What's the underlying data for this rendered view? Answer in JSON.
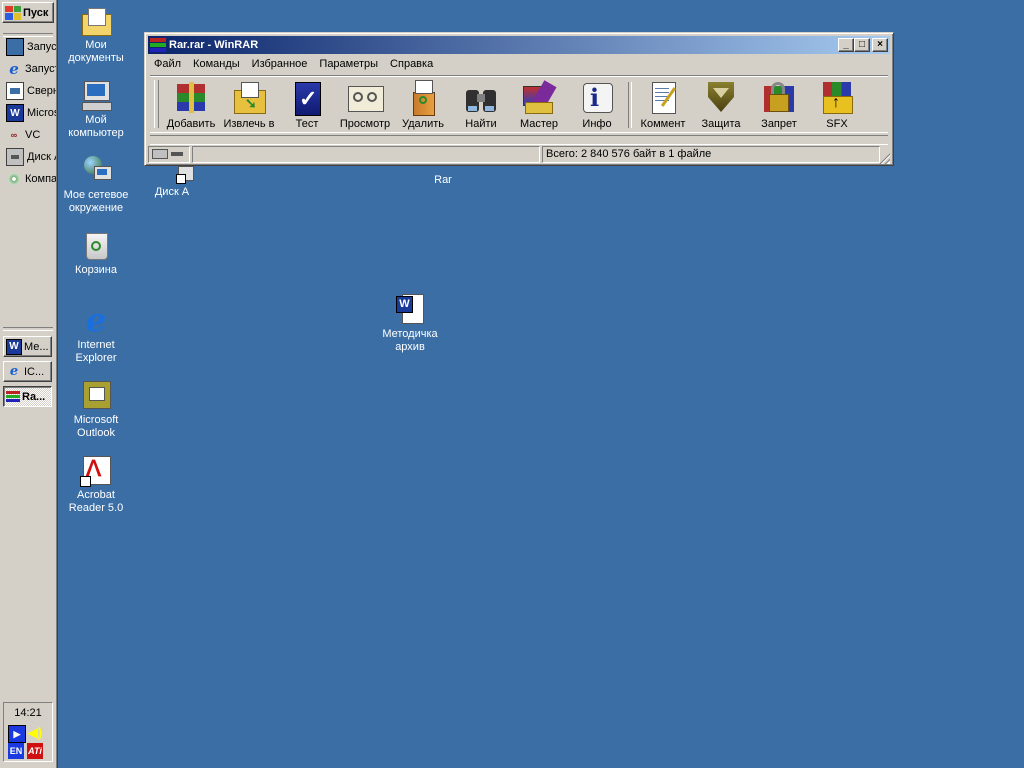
{
  "taskbar": {
    "start_label": "Пуск",
    "quick_launch": [
      {
        "label": "Запустить",
        "icon": "explorer-icon",
        "color": "#3a6ea5"
      },
      {
        "label": "Запустить Internet Explorer",
        "icon": "ie-icon",
        "color": "#1a5fd0"
      },
      {
        "label": "Свернуть все окна",
        "icon": "desktop-icon",
        "color": "#3a6ea5"
      },
      {
        "label": "Microsoft Word",
        "icon": "word-icon",
        "color": "#1a3a9a"
      },
      {
        "label": "VC",
        "icon": "vc-icon",
        "color": "#8a1a1a"
      },
      {
        "label": "Диск A",
        "icon": "floppy-icon",
        "color": "#555555"
      },
      {
        "label": "Компакт-диск",
        "icon": "cd-icon",
        "color": "#2a7a2a"
      }
    ],
    "tasks": [
      {
        "label": "Ме...",
        "icon": "word-icon"
      },
      {
        "label": "IC...",
        "icon": "ie-icon"
      },
      {
        "label": "Ra...",
        "icon": "winrar-icon"
      }
    ],
    "clock": "14:21",
    "tray": {
      "lang": "EN"
    }
  },
  "desktop": {
    "icons": [
      {
        "label": "Мои документы",
        "icon": "my-documents-icon"
      },
      {
        "label": "Мой компьютер",
        "icon": "my-computer-icon"
      },
      {
        "label": "Мое сетевое окружение",
        "icon": "network-icon"
      },
      {
        "label": "Корзина",
        "icon": "recycle-bin-icon"
      },
      {
        "label": "Internet Explorer",
        "icon": "internet-explorer-icon"
      },
      {
        "label": "Microsoft Outlook",
        "icon": "outlook-icon"
      },
      {
        "label": "Acrobat Reader 5.0",
        "icon": "acrobat-icon"
      },
      {
        "label": "Диск A",
        "icon": "floppy-shortcut-icon"
      },
      {
        "label": "Rar",
        "icon": "rar-folder-icon"
      },
      {
        "label": "Методичка архив",
        "icon": "word-document-icon"
      }
    ]
  },
  "window": {
    "title": "Rar.rar - WinRAR",
    "menu": [
      "Файл",
      "Команды",
      "Избранное",
      "Параметры",
      "Справка"
    ],
    "toolbar": [
      {
        "label": "Добавить",
        "icon": "add-icon"
      },
      {
        "label": "Извлечь в",
        "icon": "extract-icon"
      },
      {
        "label": "Тест",
        "icon": "test-icon"
      },
      {
        "label": "Просмотр",
        "icon": "view-icon"
      },
      {
        "label": "Удалить",
        "icon": "delete-icon"
      },
      {
        "label": "Найти",
        "icon": "find-icon"
      },
      {
        "label": "Мастер",
        "icon": "wizard-icon"
      },
      {
        "label": "Инфо",
        "icon": "info-icon"
      },
      {
        "label": "Коммент",
        "icon": "comment-icon"
      },
      {
        "label": "Защита",
        "icon": "protect-icon"
      },
      {
        "label": "Запрет",
        "icon": "lock-icon"
      },
      {
        "label": "SFX",
        "icon": "sfx-icon"
      }
    ],
    "status": {
      "total": "Всего: 2 840 576 байт в 1 файле"
    }
  },
  "colors": {
    "desktop_bg": "#3a6ea5",
    "title_active_start": "#0a246a",
    "title_active_end": "#a6caf0",
    "face": "#d4d0c8"
  }
}
